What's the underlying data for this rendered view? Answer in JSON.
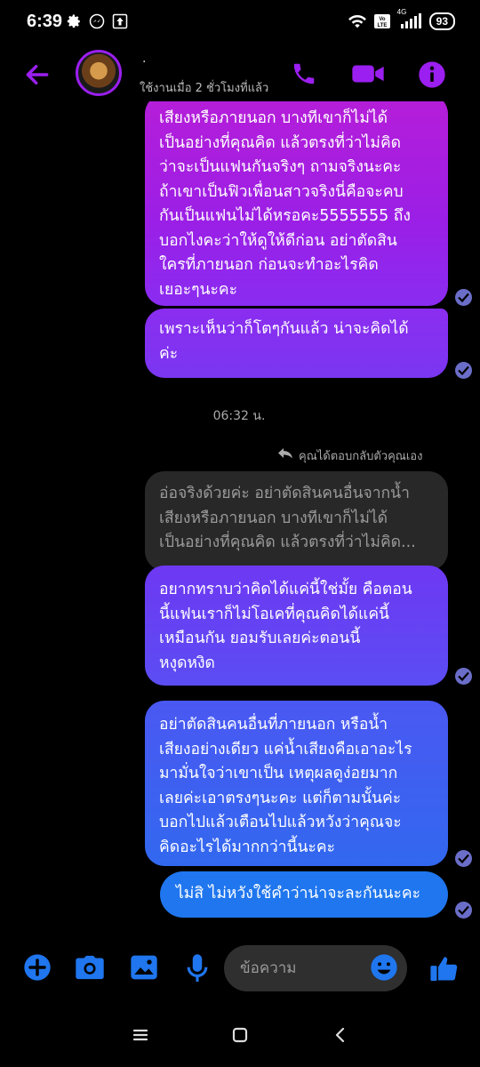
{
  "status": {
    "time": "6:39",
    "battery": "93",
    "network": "4G"
  },
  "header": {
    "contact_name": "·",
    "activity": "ใช้งานเมื่อ 2 ชั่วโมงที่แล้ว",
    "icons": [
      "back-arrow-icon",
      "phone-icon",
      "video-camera-icon",
      "info-icon"
    ],
    "accent_color": "#9b1ff0"
  },
  "messages": [
    {
      "text": "เสียงหรือภายนอก บางทีเขาก็ไม่ได้\nเป็นอย่างที่คุณคิด แล้วตรงที่ว่าไม่คิด\nว่าจะเป็นแฟนกันจริงๆ ถามจริงนะคะ\nถ้าเขาเป็นฟิวเพื่อนสาวจริงนี่คือจะคบ\nกันเป็นแฟนไม่ได้หรอคะ5555555 ถึง\nบอกไงคะว่าให้ดูให้ดีก่อน อย่าตัดสิน\nใครที่ภายนอก ก่อนจะทำอะไรคิด\nเยอะๆนะคะ"
    },
    {
      "text": "เพราะเห็นว่าก็โตๆกันแล้ว น่าจะคิดได้\nค่ะ"
    },
    {
      "text": "อยากทราบว่าคิดได้แค่นี้ใช่มั้ย คือตอน\nนี้แฟนเราก็ไม่โอเคที่คุณคิดได้แค่นี้\nเหมือนกัน ยอมรับเลยค่ะตอนนี้\nหงุดหงิด"
    },
    {
      "text": "อย่าตัดสินคนอื่นที่ภายนอก หรือน้ำ\nเสียงอย่างเดียว แค่น้ำเสียงคือเอาอะไร\nมามั่นใจว่าเขาเป็น เหตุผลดูง่อยมาก\nเลยค่ะเอาตรงๆนะคะ แต่ก็ตามนั้นค่ะ\nบอกไปแล้วเตือนไปแล้วหวังว่าคุณจะ\nคิดอะไรได้มากกว่านี้นะคะ"
    },
    {
      "text": "ไม่สิ ไม่หวังใช้คำว่าน่าจะละกันนะคะ"
    }
  ],
  "timestamp": "06:32 น.",
  "reply_note": "คุณได้ตอบกลับตัวคุณเอง",
  "quoted_message": "อ่อจริงด้วยค่ะ อย่าตัดสินคนอื่นจากน้ำ\nเสียงหรือภายนอก บางทีเขาก็ไม่ได้\nเป็นอย่างที่คุณคิด แล้วตรงที่ว่าไม่คิด...",
  "composer": {
    "placeholder": "ข้อความ",
    "icons": [
      "plus-icon",
      "camera-icon",
      "gallery-icon",
      "microphone-icon",
      "emoji-icon",
      "thumbs-up-icon"
    ]
  },
  "colors": {
    "composer_blue": "#1f76ee",
    "seen_check": "#6a6ec8"
  }
}
